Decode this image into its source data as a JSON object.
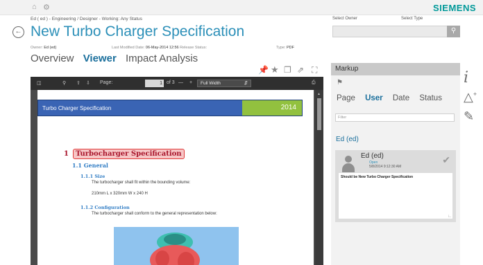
{
  "header": {
    "home_icon": "home-icon",
    "settings_icon": "gear-icon",
    "brand": "SIEMENS",
    "breadcrumb": "Ed ( ed ) - Engineering / Designer - Working: Any Status",
    "title": "New Turbo Charger Specification",
    "meta": {
      "owner_label": "Owner:",
      "owner_value": "Ed (ed)",
      "modified_label": "Last Modified Date:",
      "modified_value": "06-May-2014 12:56",
      "release_label": "Release Status:",
      "type_label": "Type:",
      "type_value": "PDF"
    }
  },
  "tabs": [
    {
      "label": "Overview",
      "active": false
    },
    {
      "label": "Viewer",
      "active": true
    },
    {
      "label": "Impact Analysis",
      "active": false
    }
  ],
  "viewer_toolbar_icons": [
    "pin-icon",
    "star-icon",
    "copy-icon",
    "export-icon",
    "fullscreen-icon"
  ],
  "pdf_toolbar": {
    "page_label": "Page:",
    "page_value": "1",
    "page_total": "of 3",
    "minus": "—",
    "plus": "+",
    "zoom": "Full Width"
  },
  "document": {
    "header_title": "Turbo Charger Specification",
    "header_year": "2014",
    "h1_number": "1",
    "h1_text": "Turbocharger Specification",
    "h2": "1.1 General",
    "sections": [
      {
        "heading": "1.1.1 Size",
        "lines": [
          "The turbocharger shall fit within the bounding volume:",
          "210mm L x 320mm W x 240 H"
        ]
      },
      {
        "heading": "1.1.2 Configuration",
        "lines": [
          "The turbocharger shall conform to the general representation below:"
        ]
      }
    ]
  },
  "owner_search": {
    "owner_label": "Select Owner",
    "type_label": "Select Type"
  },
  "markup": {
    "title": "Markup",
    "sort_options": [
      {
        "label": "Page",
        "active": false
      },
      {
        "label": "User",
        "active": true
      },
      {
        "label": "Date",
        "active": false
      },
      {
        "label": "Status",
        "active": false
      }
    ],
    "filter_placeholder": "Filter",
    "group_label": "Ed (ed)",
    "comment": {
      "author": "Ed (ed)",
      "status": "Open",
      "date": "5/8/2014 9:12:30 AM",
      "text": "Should be New Turbo Charger Specification"
    }
  },
  "side_icons": [
    "info-icon",
    "add-markup-icon",
    "edit-markup-icon"
  ],
  "colors": {
    "brand": "#009999",
    "title_blue": "#2b8fb8",
    "doc_header_blue": "#3a64b4",
    "doc_header_green": "#92c13f",
    "heading_red": "#a8142b"
  }
}
